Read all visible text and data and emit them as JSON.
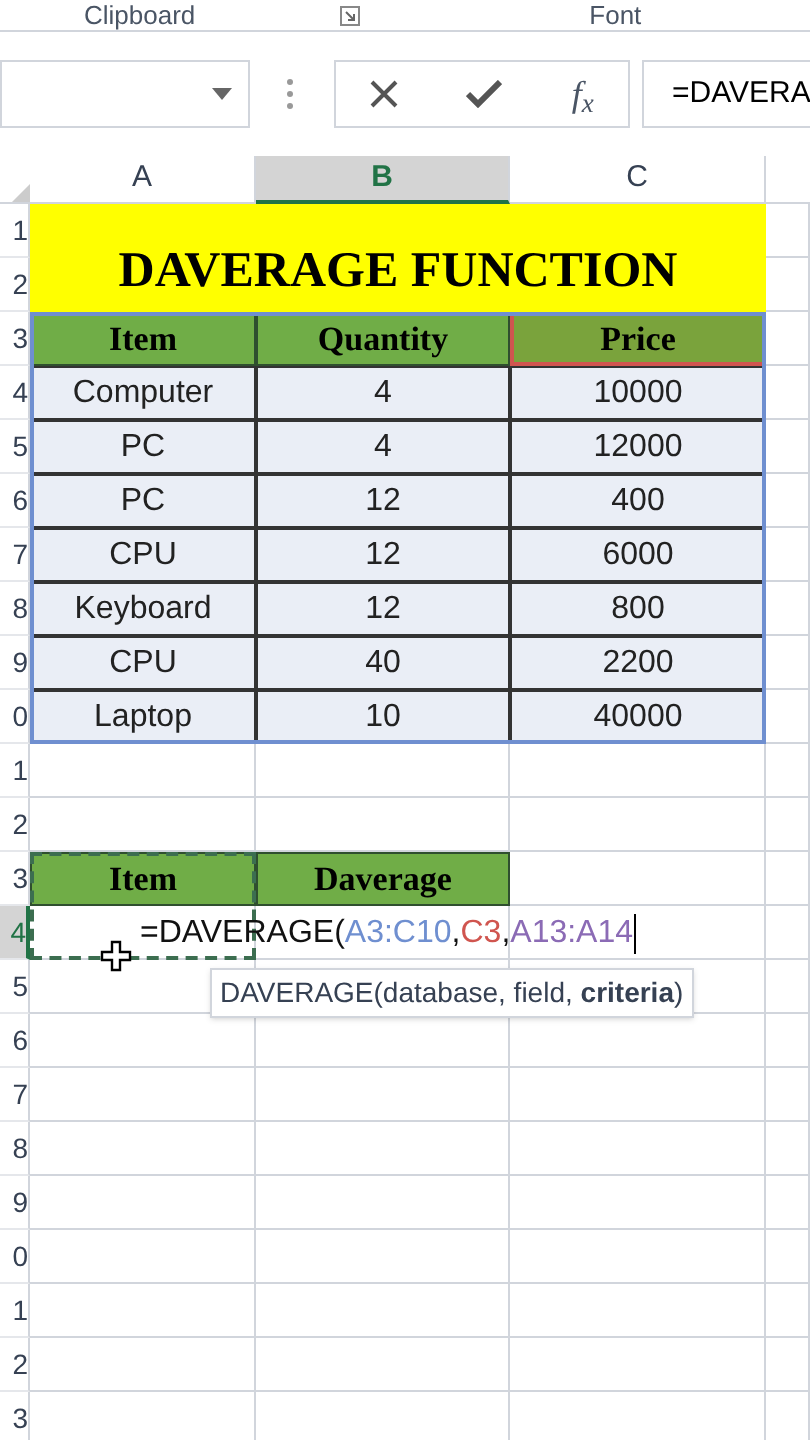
{
  "ribbon_groups": [
    {
      "label": "Clipboard"
    },
    {
      "label": "Font"
    }
  ],
  "formula_bar": {
    "function_label": "f$_{x}$",
    "formula": "=DAVERA"
  },
  "columns": [
    {
      "label": "A",
      "selected": false
    },
    {
      "label": "B",
      "selected": true
    },
    {
      "label": "C",
      "selected": false
    }
  ],
  "row_numbers": [
    {
      "label": "1",
      "selected": false
    },
    {
      "label": "2",
      "selected": false
    },
    {
      "label": "3",
      "selected": false
    },
    {
      "label": "4",
      "selected": false
    },
    {
      "label": "5",
      "selected": false
    },
    {
      "label": "6",
      "selected": false
    },
    {
      "label": "7",
      "selected": false
    },
    {
      "label": "8",
      "selected": false
    },
    {
      "label": "9",
      "selected": false
    },
    {
      "label": "0",
      "selected": false
    },
    {
      "label": "1",
      "selected": false
    },
    {
      "label": "2",
      "selected": false
    },
    {
      "label": "3",
      "selected": false
    },
    {
      "label": "4",
      "selected": true
    },
    {
      "label": "5",
      "selected": false
    },
    {
      "label": "6",
      "selected": false
    },
    {
      "label": "7",
      "selected": false
    },
    {
      "label": "8",
      "selected": false
    },
    {
      "label": "9",
      "selected": false
    },
    {
      "label": "0",
      "selected": false
    },
    {
      "label": "1",
      "selected": false
    },
    {
      "label": "2",
      "selected": false
    },
    {
      "label": "3",
      "selected": false
    }
  ],
  "title": "DAVERAGE FUNCTION",
  "table": {
    "columns": [
      {
        "label": "Item",
        "referenced": false
      },
      {
        "label": "Quantity",
        "referenced": false
      },
      {
        "label": "Price",
        "referenced": true
      }
    ],
    "rows": [
      [
        "Computer",
        "4",
        "10000"
      ],
      [
        "PC",
        "4",
        "12000"
      ],
      [
        "PC",
        "12",
        "400"
      ],
      [
        "CPU",
        "12",
        "6000"
      ],
      [
        "Keyboard",
        "12",
        "800"
      ],
      [
        "CPU",
        "40",
        "2200"
      ],
      [
        "Laptop",
        "10",
        "40000"
      ]
    ]
  },
  "criteria": {
    "columns": [
      "Item",
      "Daverage"
    ]
  },
  "formula_cell": {
    "segments": [
      {
        "text": "=DAVERAGE(",
        "color": "#111111"
      },
      {
        "text": "A3:C10",
        "color": "#6f8fd0"
      },
      {
        "text": ",",
        "color": "#111111"
      },
      {
        "text": "C3",
        "color": "#d0554f"
      },
      {
        "text": ",",
        "color": "#111111"
      },
      {
        "text": "A13:A14",
        "color": "#8b6bb5"
      }
    ]
  },
  "tooltip": "DAVERAGE(database, field, **criteria**)"
}
